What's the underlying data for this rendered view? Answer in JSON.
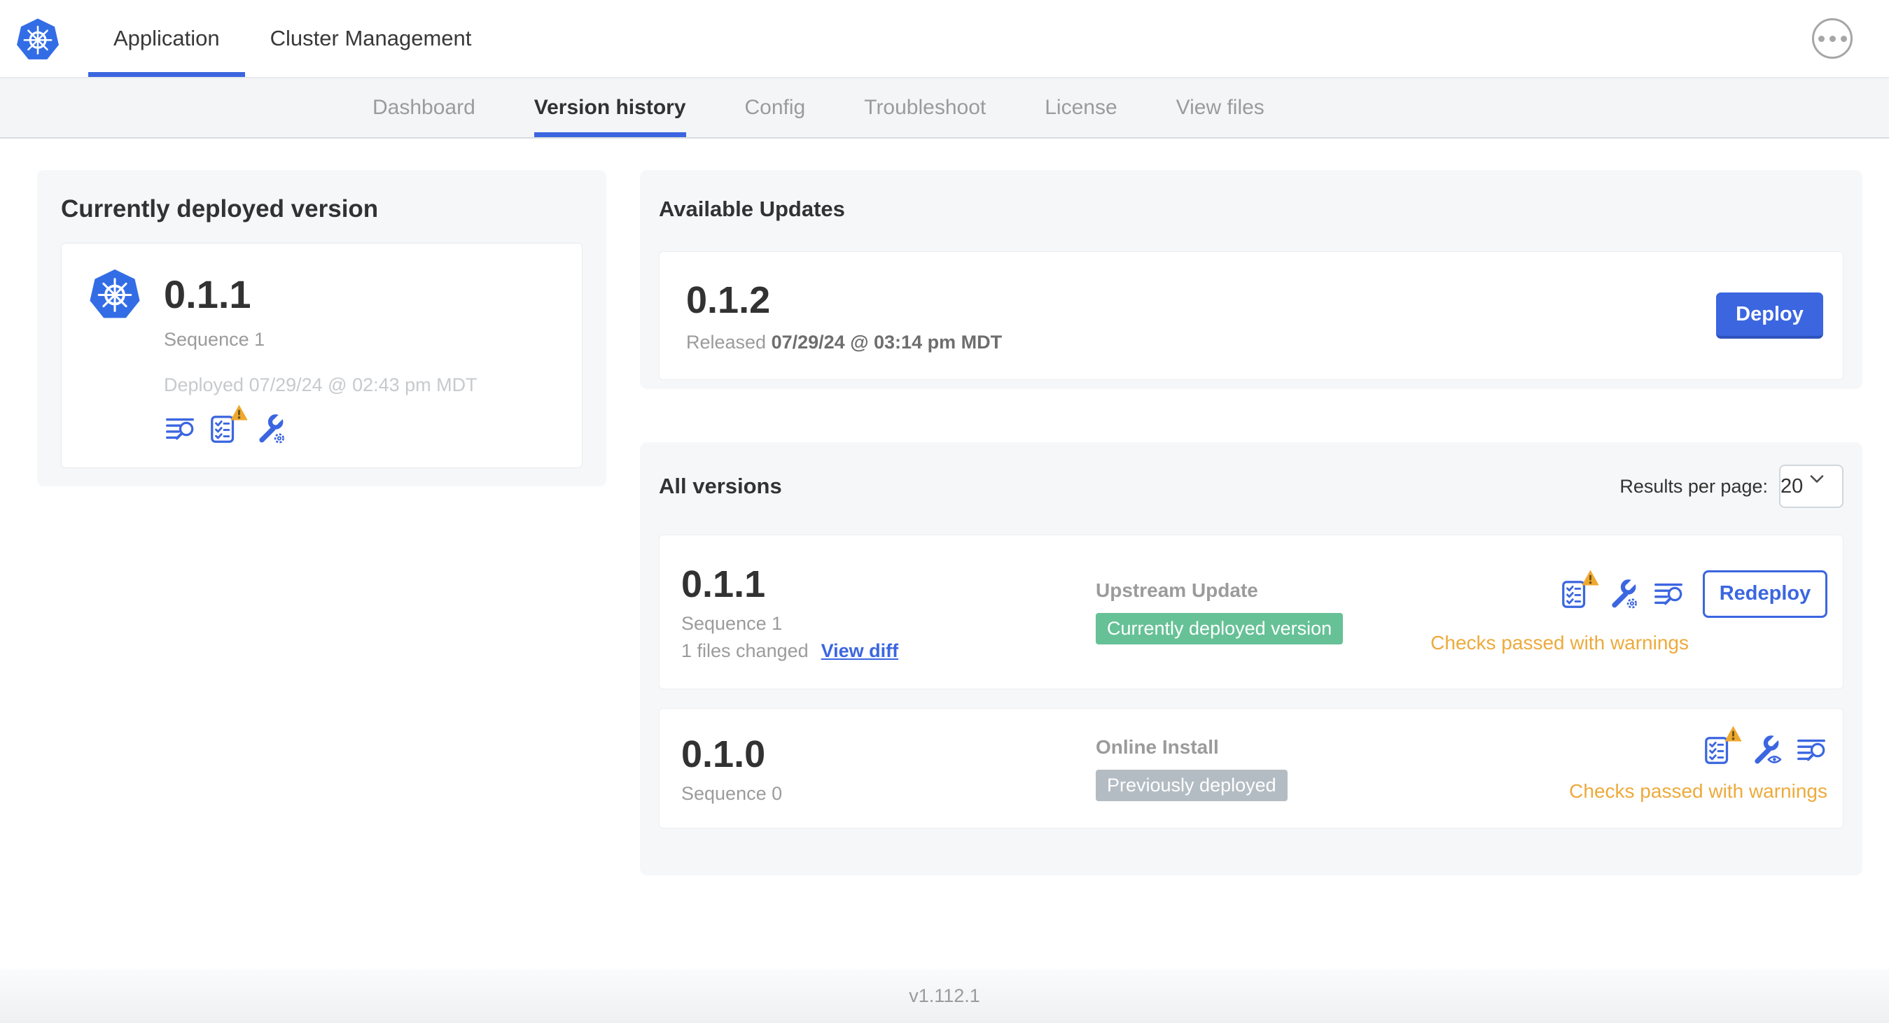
{
  "top_nav": {
    "logo_icon": "kubernetes-logo",
    "tabs": [
      {
        "label": "Application",
        "active": true
      },
      {
        "label": "Cluster Management",
        "active": false
      }
    ],
    "menu_icon": "ellipsis-menu-icon"
  },
  "sub_nav": {
    "tabs": [
      {
        "label": "Dashboard",
        "active": false
      },
      {
        "label": "Version history",
        "active": true
      },
      {
        "label": "Config",
        "active": false
      },
      {
        "label": "Troubleshoot",
        "active": false
      },
      {
        "label": "License",
        "active": false
      },
      {
        "label": "View files",
        "active": false
      }
    ]
  },
  "current_version_card": {
    "title": "Currently deployed version",
    "version": "0.1.1",
    "sequence": "Sequence 1",
    "deployed_timestamp": "Deployed 07/29/24 @ 02:43 pm MDT",
    "icons": [
      "release-notes-icon",
      "preflight-checks-warning-icon",
      "edit-config-icon"
    ]
  },
  "available_updates_card": {
    "title": "Available Updates",
    "update": {
      "version": "0.1.2",
      "released_label": "Released",
      "released_timestamp": "07/29/24 @ 03:14 pm MDT",
      "deploy_button_label": "Deploy"
    }
  },
  "all_versions_card": {
    "title": "All versions",
    "results_per_page_label": "Results per page:",
    "results_per_page_value": "20",
    "rows": [
      {
        "version": "0.1.1",
        "sequence": "Sequence 1",
        "files_changed": "1 files changed",
        "view_diff_label": "View diff",
        "source": "Upstream Update",
        "badge_label": "Currently deployed version",
        "badge_color": "#66c196",
        "icons": [
          "preflight-checks-warning-icon",
          "edit-config-icon",
          "release-notes-icon"
        ],
        "action_button_label": "Redeploy",
        "status_text": "Checks passed with warnings"
      },
      {
        "version": "0.1.0",
        "sequence": "Sequence 0",
        "source": "Online Install",
        "badge_label": "Previously deployed",
        "badge_color": "#b3bcc3",
        "icons": [
          "preflight-checks-warning-icon",
          "view-config-icon",
          "release-notes-icon"
        ],
        "status_text": "Checks passed with warnings"
      }
    ]
  },
  "footer": {
    "version_text": "v1.112.1"
  },
  "colors": {
    "accent_blue": "#3b66e0",
    "kubernetes_blue": "#326de6",
    "success_green": "#66c196",
    "neutral_badge_gray": "#b3bcc3",
    "warning_amber": "#edaa3c"
  }
}
